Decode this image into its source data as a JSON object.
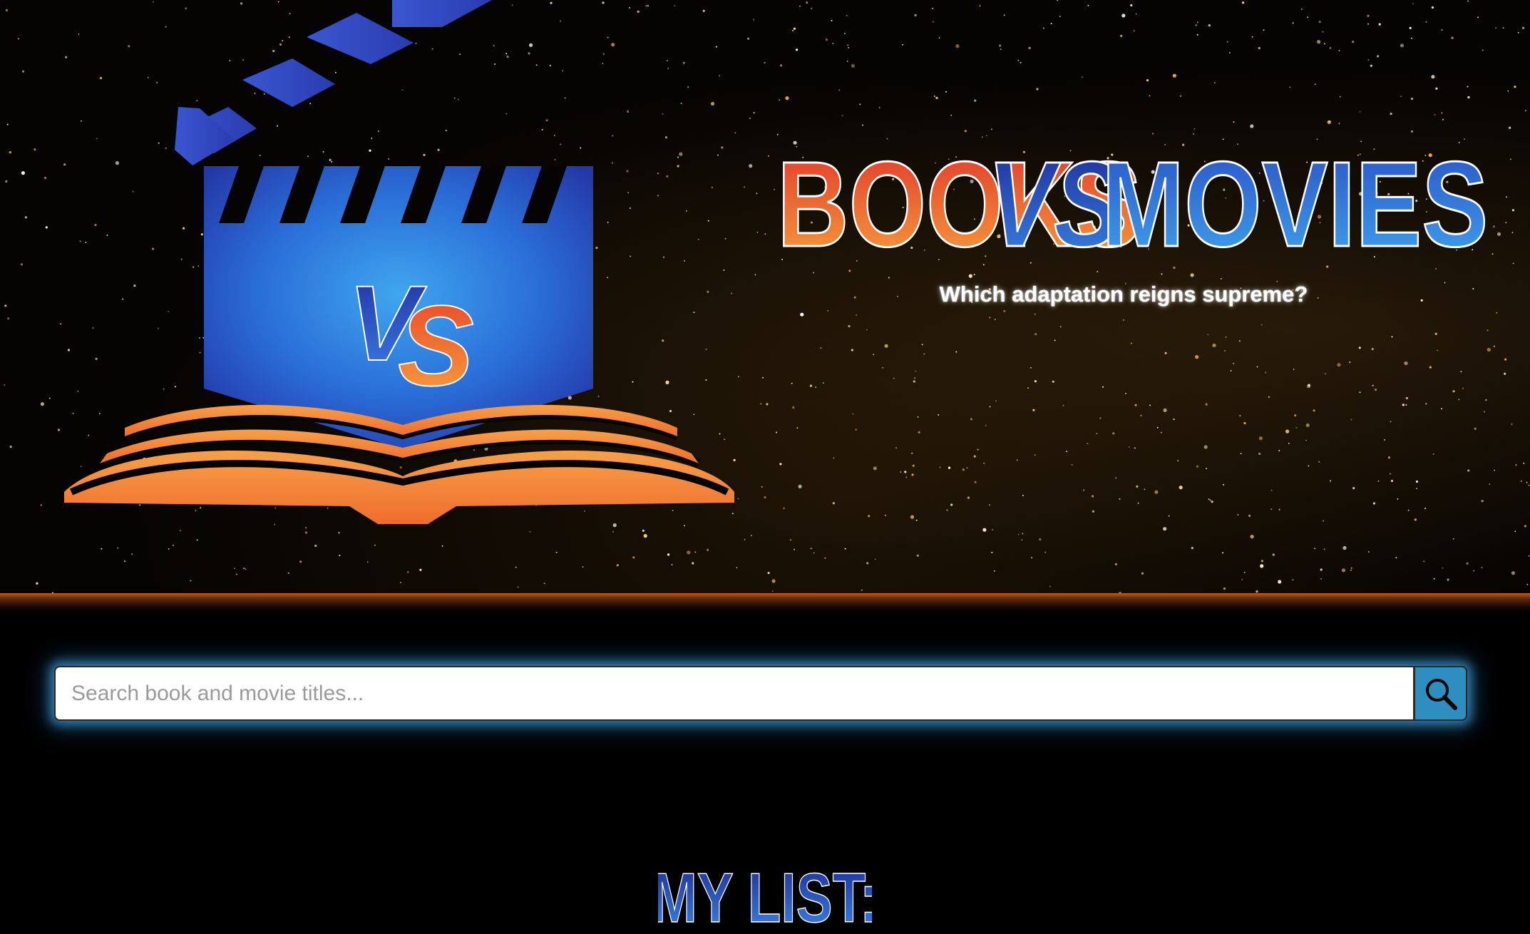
{
  "header": {
    "brand": {
      "word_books": "BOOKS",
      "word_vs": "VS",
      "word_movies": "MOVIES"
    },
    "logo_text": "VS",
    "tagline": "Which adaptation reigns supreme?"
  },
  "search": {
    "placeholder": "Search book and movie titles...",
    "value": "",
    "button_icon": "magnifier-icon"
  },
  "list": {
    "heading": "MY LIST:"
  },
  "colors": {
    "background": "#000000",
    "orange_accent": "#f07a2c",
    "blue_accent": "#2a6ed8",
    "search_glow": "#50beff",
    "search_button": "#2f8ec0"
  }
}
